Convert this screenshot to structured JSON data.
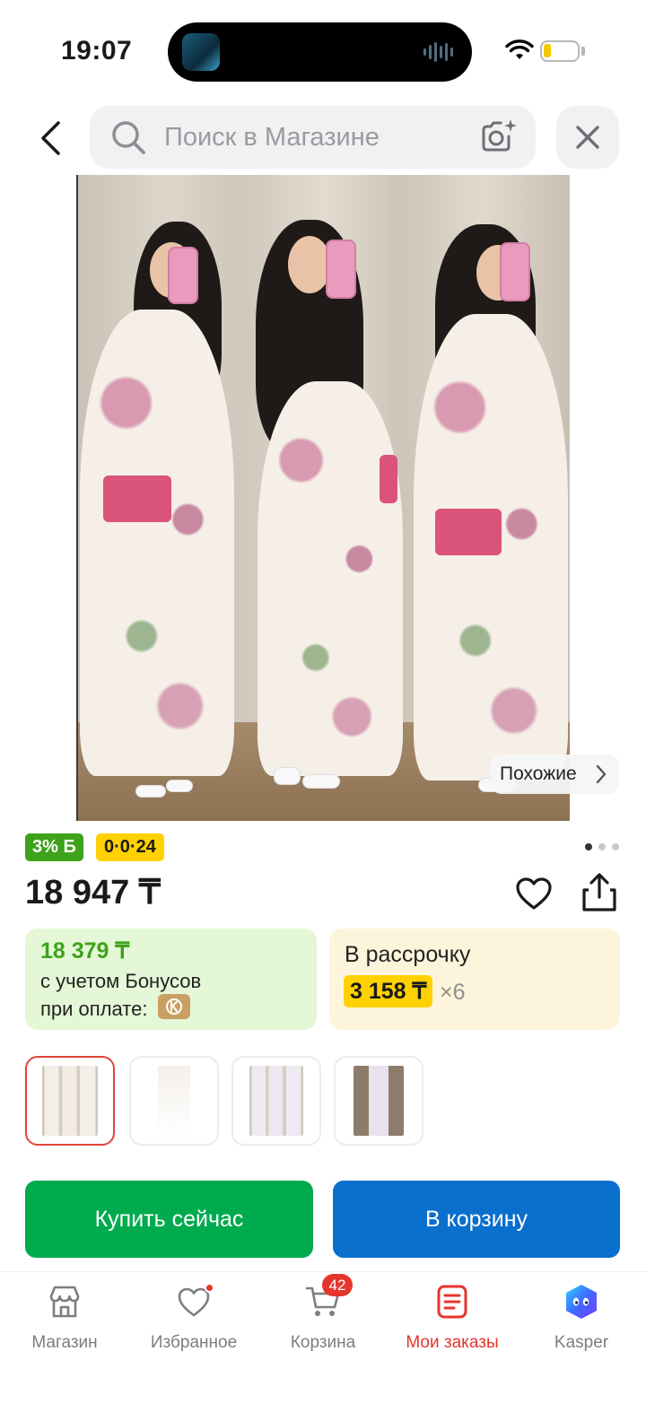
{
  "status_bar": {
    "time": "19:07"
  },
  "header": {
    "search_placeholder": "Поиск в Магазине",
    "icons": [
      "back-arrow-icon",
      "search-icon",
      "camera-search-icon",
      "close-icon"
    ]
  },
  "gallery": {
    "similar_label": "Похожие",
    "page_count": 3,
    "active_page": 1,
    "thumbnails_count": 4,
    "selected_thumbnail": 1
  },
  "badges": {
    "bonus": "3% Б",
    "installment": "0·0·24"
  },
  "product": {
    "price": "18 947 ₸"
  },
  "offers": {
    "bonus_price": "18 379 ₸",
    "bonus_line1": "с учетом Бонусов",
    "bonus_line2": "при оплате:",
    "installment_title": "В рассрочку",
    "installment_amount": "3 158 ₸",
    "installment_months": "×6"
  },
  "actions": {
    "buy_now": "Купить сейчас",
    "add_to_cart": "В корзину"
  },
  "tabbar": {
    "items": [
      {
        "label": "Магазин",
        "icon": "store-icon"
      },
      {
        "label": "Избранное",
        "icon": "heart-icon"
      },
      {
        "label": "Корзина",
        "icon": "cart-icon",
        "badge": "42"
      },
      {
        "label": "Мои заказы",
        "icon": "orders-icon",
        "active": true
      },
      {
        "label": "Kasper",
        "icon": "kasper-icon"
      }
    ]
  },
  "colors": {
    "accent_red": "#e5362c",
    "buy_green": "#00ab4e",
    "cart_blue": "#0a6fcd",
    "bonus_green": "#3ea21b",
    "installment_yellow": "#ffd100"
  }
}
